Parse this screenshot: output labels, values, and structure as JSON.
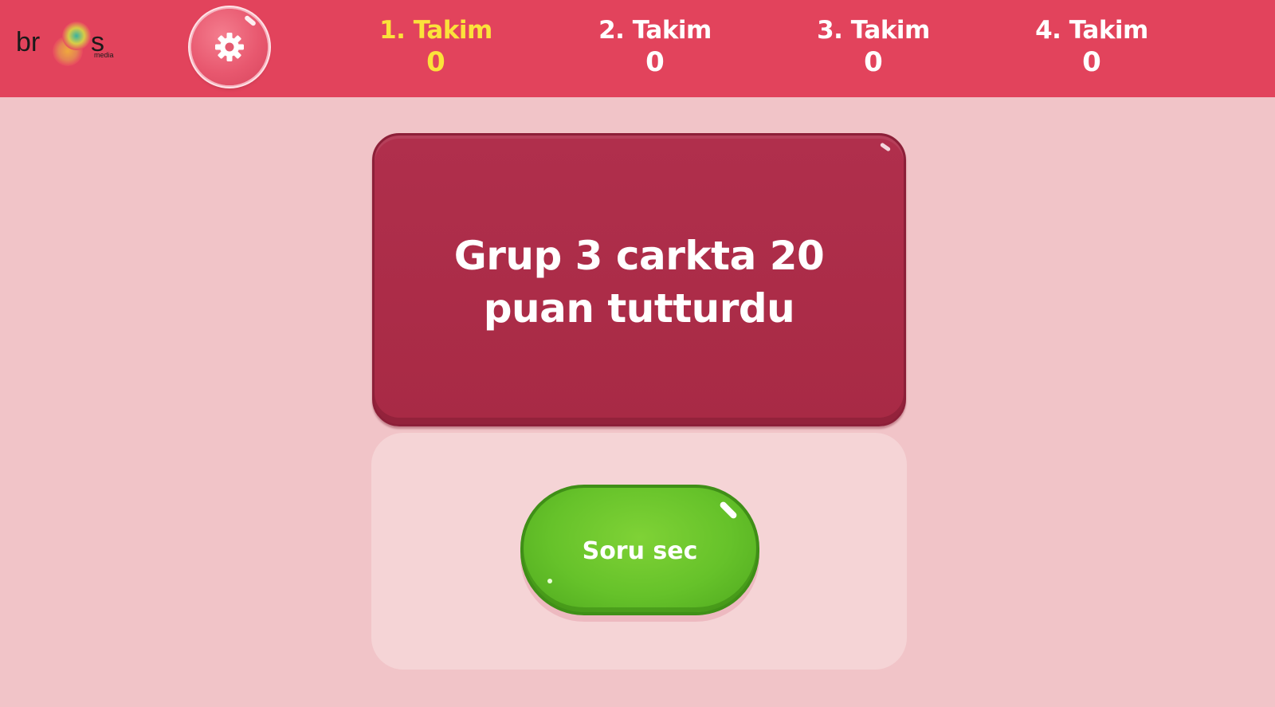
{
  "logo": {
    "text": "bros",
    "subtext": "media"
  },
  "settings": {
    "icon": "gear-icon"
  },
  "teams": [
    {
      "name": "1. Takim",
      "score": "0",
      "active": true
    },
    {
      "name": "2. Takim",
      "score": "0",
      "active": false
    },
    {
      "name": "3. Takim",
      "score": "0",
      "active": false
    },
    {
      "name": "4. Takim",
      "score": "0",
      "active": false
    }
  ],
  "message": {
    "text": "Grup 3 carkta 20 puan tutturdu"
  },
  "action": {
    "button_label": "Soru sec"
  },
  "colors": {
    "header": "#e2435c",
    "background": "#f1c4c8",
    "active_team": "#fbe23a",
    "message_card": "#a82a45",
    "button": "#66c22a"
  }
}
